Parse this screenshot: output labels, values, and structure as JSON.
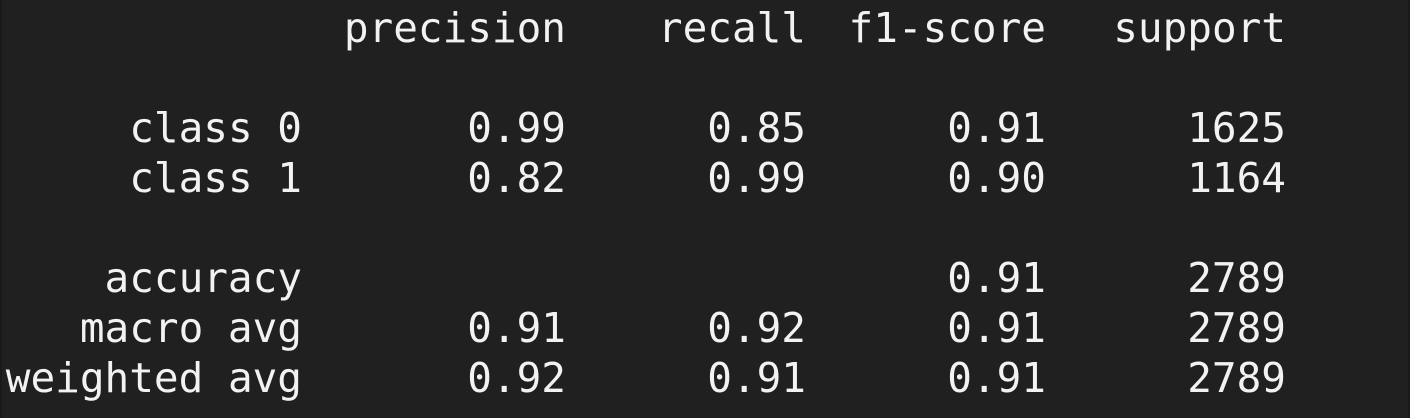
{
  "report": {
    "header": {
      "precision": "precision",
      "recall": "recall",
      "f1": "f1-score",
      "support": "support"
    },
    "classes": [
      {
        "label": "class 0",
        "precision": "0.99",
        "recall": "0.85",
        "f1": "0.91",
        "support": "1625"
      },
      {
        "label": "class 1",
        "precision": "0.82",
        "recall": "0.99",
        "f1": "0.90",
        "support": "1164"
      }
    ],
    "accuracy": {
      "label": "accuracy",
      "f1": "0.91",
      "support": "2789"
    },
    "macro_avg": {
      "label": "macro avg",
      "precision": "0.91",
      "recall": "0.92",
      "f1": "0.91",
      "support": "2789"
    },
    "weighted_avg": {
      "label": "weighted avg",
      "precision": "0.92",
      "recall": "0.91",
      "f1": "0.91",
      "support": "2789"
    }
  },
  "colors": {
    "background": "#202020",
    "text": "#f2f2f2"
  }
}
